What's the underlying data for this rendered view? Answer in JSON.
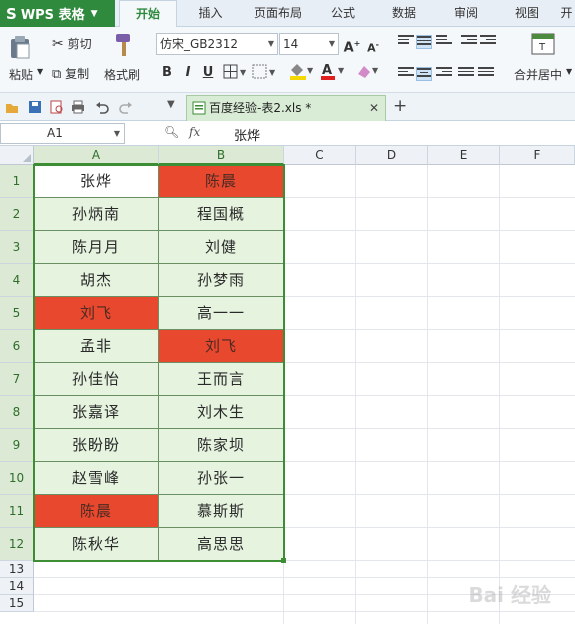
{
  "app": {
    "name": "WPS 表格",
    "logo": "S"
  },
  "tabs": [
    {
      "label": "开始",
      "active": true
    },
    {
      "label": "插入",
      "active": false
    },
    {
      "label": "页面布局",
      "active": false
    },
    {
      "label": "公式",
      "active": false
    },
    {
      "label": "数据",
      "active": false
    },
    {
      "label": "审阅",
      "active": false
    },
    {
      "label": "视图",
      "active": false
    },
    {
      "label": "开",
      "active": false
    }
  ],
  "ribbon": {
    "cut_label": "剪切",
    "paste_label": "粘贴",
    "copy_label": "复制",
    "format_painter_label": "格式刷",
    "font_name": "仿宋_GB2312",
    "font_size": "14",
    "bold": "B",
    "italic": "I",
    "underline": "U",
    "merge_center_label": "合并居中"
  },
  "doc_tab": {
    "title": "百度经验-表2.xls *"
  },
  "formula_bar": {
    "cell_ref": "A1",
    "fx": "fx",
    "value": "张烨"
  },
  "columns": [
    "A",
    "B",
    "C",
    "D",
    "E",
    "F"
  ],
  "rows": [
    "1",
    "2",
    "3",
    "4",
    "5",
    "6",
    "7",
    "8",
    "9",
    "10",
    "11",
    "12",
    "13",
    "14",
    "15"
  ],
  "table": [
    {
      "a": "张烨",
      "b": "陈晨",
      "a_fill": "white",
      "b_fill": "red"
    },
    {
      "a": "孙炳南",
      "b": "程国概",
      "a_fill": "green",
      "b_fill": "green"
    },
    {
      "a": "陈月月",
      "b": "刘健",
      "a_fill": "green",
      "b_fill": "green"
    },
    {
      "a": "胡杰",
      "b": "孙梦雨",
      "a_fill": "green",
      "b_fill": "green"
    },
    {
      "a": "刘飞",
      "b": "高一一",
      "a_fill": "red",
      "b_fill": "green"
    },
    {
      "a": "孟非",
      "b": "刘飞",
      "a_fill": "green",
      "b_fill": "red"
    },
    {
      "a": "孙佳怡",
      "b": "王而言",
      "a_fill": "green",
      "b_fill": "green"
    },
    {
      "a": "张嘉译",
      "b": "刘木生",
      "a_fill": "green",
      "b_fill": "green"
    },
    {
      "a": "张盼盼",
      "b": "陈家坝",
      "a_fill": "green",
      "b_fill": "green"
    },
    {
      "a": "赵雪峰",
      "b": "孙张一",
      "a_fill": "green",
      "b_fill": "green"
    },
    {
      "a": "陈晨",
      "b": "慕斯斯",
      "a_fill": "red",
      "b_fill": "green"
    },
    {
      "a": "陈秋华",
      "b": "高思思",
      "a_fill": "green",
      "b_fill": "green"
    }
  ],
  "colors": {
    "accent": "#2f8a3e",
    "highlight_red": "#e8482e",
    "fill_green": "#e5f3df"
  },
  "watermark": "Bai 经验"
}
